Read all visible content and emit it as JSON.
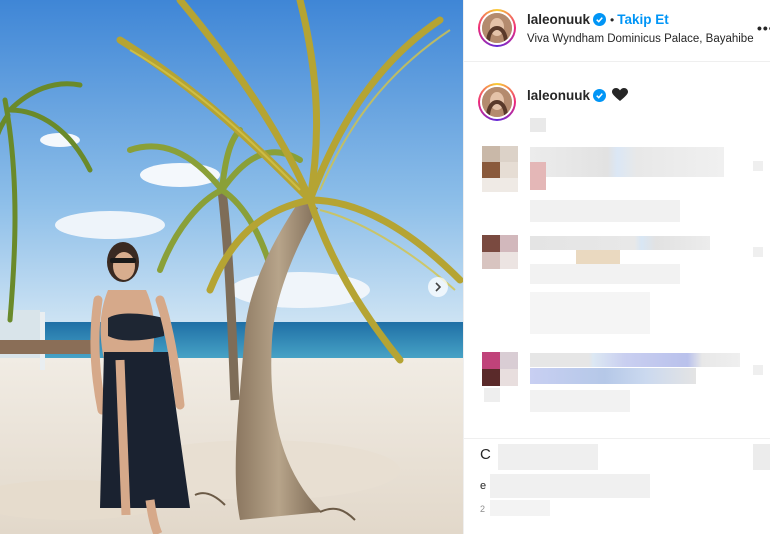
{
  "post": {
    "username": "laleonuuk",
    "follow_label": "Takip Et",
    "separator": "•",
    "location": "Viva Wyndham Dominicus Palace, Bayahibe",
    "more_glyph": "•••"
  },
  "caption": {
    "username": "laleonuuk"
  },
  "colors": {
    "follow_blue": "#0095f6",
    "verified_blue": "#0095f6",
    "text_primary": "#262626"
  },
  "icons": [
    "verified-badge-icon",
    "black-heart-icon",
    "more-options-icon",
    "carousel-next-icon"
  ],
  "footer": {
    "initial_c": "C",
    "initial_e": "e",
    "initial_2": "2"
  }
}
